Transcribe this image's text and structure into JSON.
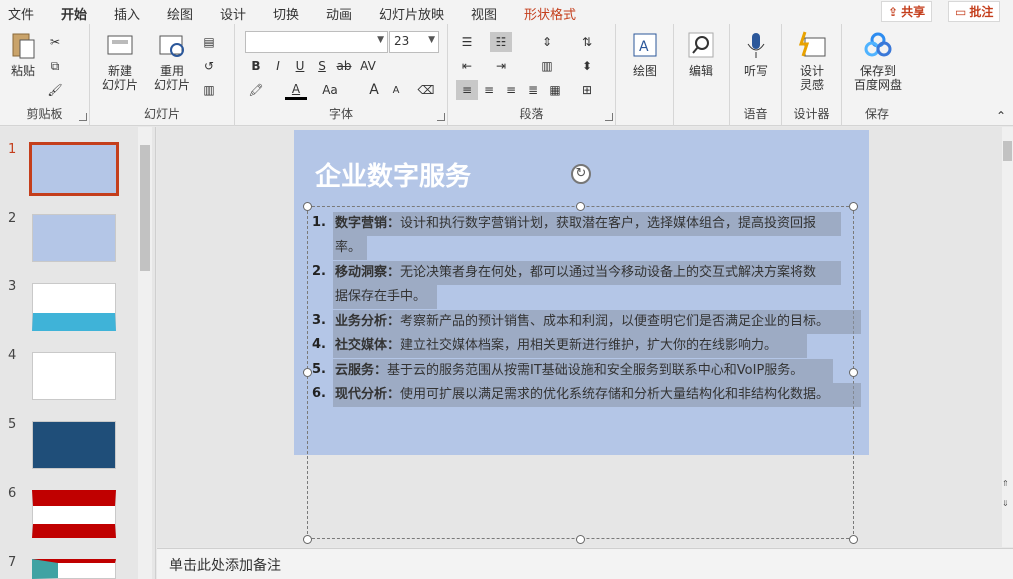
{
  "tabs": [
    "文件",
    "开始",
    "插入",
    "绘图",
    "设计",
    "切换",
    "动画",
    "幻灯片放映",
    "视图",
    "形状格式"
  ],
  "top_buttons": {
    "share": "共享",
    "comment": "批注"
  },
  "clipboard": {
    "paste": "粘贴",
    "group": "剪贴板"
  },
  "slides_group": {
    "new_slide_1": "新建",
    "new_slide_2": "幻灯片",
    "reuse_1": "重用",
    "reuse_2": "幻灯片",
    "group": "幻灯片"
  },
  "font": {
    "name": "",
    "size": "23",
    "group": "字体",
    "bold": "B",
    "italic": "I",
    "underline": "U",
    "strike": "S",
    "abc": "ab",
    "spacing": "AV",
    "fontcolor": "A",
    "case": "Aa",
    "grow": "A",
    "shrink": "A"
  },
  "paragraph": {
    "group": "段落"
  },
  "drawing": {
    "label": "绘图"
  },
  "editing": {
    "label": "编辑"
  },
  "voice": {
    "label": "听写",
    "group": "语音"
  },
  "designer": {
    "label_1": "设计",
    "label_2": "灵感",
    "group": "设计器"
  },
  "save": {
    "label_1": "保存到",
    "label_2": "百度网盘",
    "group": "保存"
  },
  "slide_numbers": [
    "1",
    "2",
    "3",
    "4",
    "5",
    "6",
    "7"
  ],
  "slide": {
    "title": "企业数字服务",
    "items": [
      {
        "num": "1.",
        "head": "数字营销：",
        "text": "设计和执行数字营销计划，获取潜在客户，选择媒体组合，提高投资回报",
        "cont": "率。"
      },
      {
        "num": "2.",
        "head": "移动洞察：",
        "text": "无论决策者身在何处，都可以通过当今移动设备上的交互式解决方案将数",
        "cont": "据保存在手中。"
      },
      {
        "num": "3.",
        "head": "业务分析：",
        "text": "考察新产品的预计销售、成本和利润，以便查明它们是否满足企业的目标。",
        "cont": ""
      },
      {
        "num": "4.",
        "head": "社交媒体：",
        "text": "建立社交媒体档案，用相关更新进行维护，扩大你的在线影响力。",
        "cont": ""
      },
      {
        "num": "5.",
        "head": "云服务：",
        "text": "基于云的服务范围从按需IT基础设施和安全服务到联系中心和VoIP服务。",
        "cont": ""
      },
      {
        "num": "6.",
        "head": "现代分析：",
        "text": "使用可扩展以满足需求的优化系统存储和分析大量结构化和非结构化数据。",
        "cont": ""
      }
    ]
  },
  "notes_placeholder": "单击此处添加备注",
  "colors": {
    "accent": "#c43e1c",
    "slide_bg": "#b4c6e7"
  }
}
